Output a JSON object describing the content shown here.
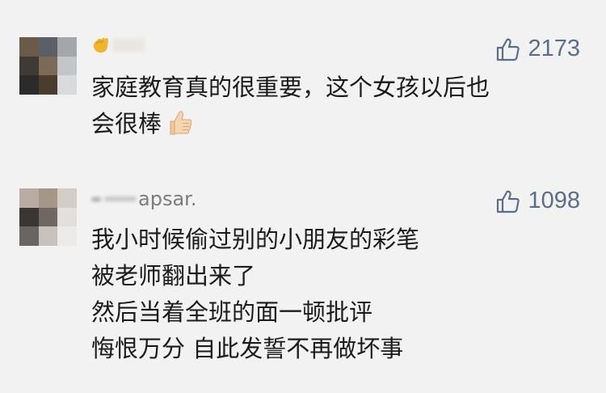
{
  "comments": [
    {
      "username": "",
      "likes": "2173",
      "lines": [
        "家庭教育真的很重要，这个女孩以后也",
        "会很棒"
      ],
      "trailing_emoji": "thumbs-up-emoji"
    },
    {
      "username": "apsar.",
      "likes": "1098",
      "lines": [
        "我小时候偷过别的小朋友的彩笔",
        "被老师翻出来了",
        "然后当着全班的面一顿批评",
        "悔恨万分 自此发誓不再做坏事"
      ]
    }
  ],
  "colors": {
    "background": "#f2f2f2",
    "like_text": "#5a6e8c",
    "content_text": "#1b1b1b"
  },
  "icons": [
    "thumbs-up-outline-icon",
    "waving-hand-emoji",
    "thumbs-up-emoji"
  ]
}
